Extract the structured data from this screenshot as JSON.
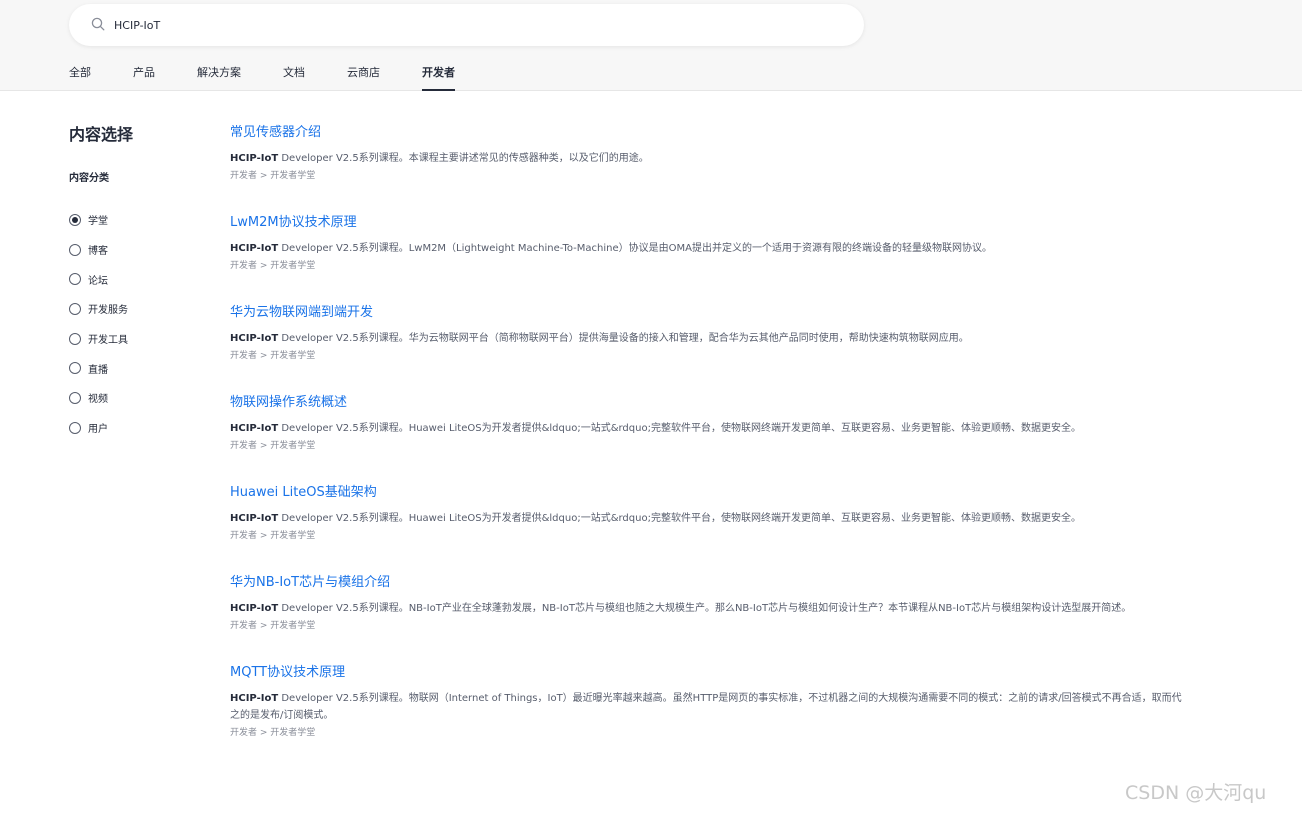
{
  "search": {
    "value": "HCIP-IoT"
  },
  "tabs": [
    {
      "label": "全部"
    },
    {
      "label": "产品"
    },
    {
      "label": "解决方案"
    },
    {
      "label": "文档"
    },
    {
      "label": "云商店"
    },
    {
      "label": "开发者",
      "active": true
    }
  ],
  "sidebar": {
    "title": "内容选择",
    "subtitle": "内容分类",
    "options": [
      {
        "label": "学堂",
        "checked": true
      },
      {
        "label": "博客"
      },
      {
        "label": "论坛"
      },
      {
        "label": "开发服务"
      },
      {
        "label": "开发工具"
      },
      {
        "label": "直播"
      },
      {
        "label": "视频"
      },
      {
        "label": "用户"
      }
    ]
  },
  "results": [
    {
      "title": "常见传感器介绍",
      "desc_bold": "HCIP-IoT",
      "desc_text": " Developer V2.5系列课程。本课程主要讲述常见的传感器种类，以及它们的用途。",
      "crumb": "开发者 > 开发者学堂"
    },
    {
      "title": "LwM2M协议技术原理",
      "desc_bold": "HCIP-IoT",
      "desc_text": " Developer V2.5系列课程。LwM2M（Lightweight Machine-To-Machine）协议是由OMA提出并定义的一个适用于资源有限的终端设备的轻量级物联网协议。",
      "crumb": "开发者 > 开发者学堂"
    },
    {
      "title": "华为云物联网端到端开发",
      "desc_bold": "HCIP-IoT",
      "desc_text": " Developer V2.5系列课程。华为云物联网平台（简称物联网平台）提供海量设备的接入和管理，配合华为云其他产品同时使用，帮助快速构筑物联网应用。",
      "crumb": "开发者 > 开发者学堂"
    },
    {
      "title": "物联网操作系统概述",
      "desc_bold": "HCIP-IoT",
      "desc_text": " Developer V2.5系列课程。Huawei LiteOS为开发者提供&ldquo;一站式&rdquo;完整软件平台，使物联网终端开发更简单、互联更容易、业务更智能、体验更顺畅、数据更安全。",
      "crumb": "开发者 > 开发者学堂"
    },
    {
      "title": "Huawei LiteOS基础架构",
      "desc_bold": "HCIP-IoT",
      "desc_text": " Developer V2.5系列课程。Huawei LiteOS为开发者提供&ldquo;一站式&rdquo;完整软件平台，使物联网终端开发更简单、互联更容易、业务更智能、体验更顺畅、数据更安全。",
      "crumb": "开发者 > 开发者学堂"
    },
    {
      "title": "华为NB-IoT芯片与模组介绍",
      "desc_bold": "HCIP-IoT",
      "desc_text": " Developer V2.5系列课程。NB-IoT产业在全球蓬勃发展，NB-IoT芯片与模组也随之大规模生产。那么NB-IoT芯片与模组如何设计生产？本节课程从NB-IoT芯片与模组架构设计选型展开简述。",
      "crumb": "开发者 > 开发者学堂"
    },
    {
      "title": "MQTT协议技术原理",
      "desc_bold": "HCIP-IoT",
      "desc_text": " Developer V2.5系列课程。物联网（Internet of Things，IoT）最近曝光率越来越高。虽然HTTP是网页的事实标准，不过机器之间的大规模沟通需要不同的模式：之前的请求/回答模式不再合适，取而代之的是发布/订阅模式。",
      "crumb": "开发者 > 开发者学堂"
    }
  ],
  "watermark": "CSDN @大河qu"
}
